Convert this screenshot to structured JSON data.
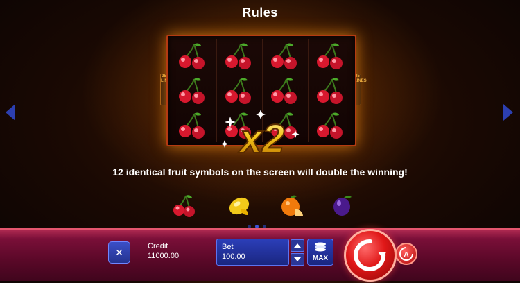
{
  "header": {
    "title": "Rules"
  },
  "reels": {
    "lines_label": "25 LINES",
    "symbol": "cherry",
    "columns": 4,
    "rows": 3
  },
  "multiplier": "x2",
  "description": "12 identical fruit symbols on the screen will double the winning!",
  "fruits": [
    "cherry",
    "lemon",
    "orange",
    "plum"
  ],
  "pagination": {
    "total": 3,
    "active": 2
  },
  "bottom_bar": {
    "credit_label": "Credit",
    "credit_value": "11000.00",
    "bet_label": "Bet",
    "bet_value": "100.00",
    "max_label": "MAX"
  },
  "colors": {
    "accent_blue": "#2c3fb0",
    "bar_red": "#7a0f38",
    "spin_red": "#e01818",
    "gold": "#f5c518"
  }
}
